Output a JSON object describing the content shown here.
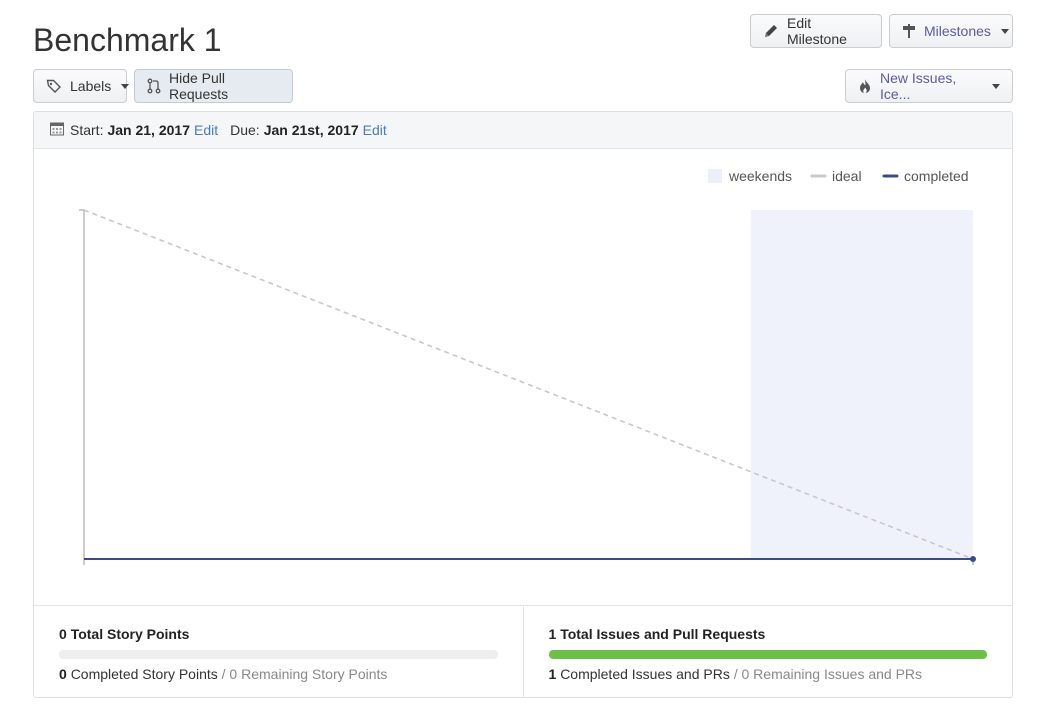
{
  "page": {
    "title": "Benchmark 1"
  },
  "toolbar": {
    "edit_milestone_label": "Edit Milestone",
    "milestones_label": "Milestones",
    "labels_label": "Labels",
    "hide_prs_label": "Hide Pull Requests",
    "mode_label": "New Issues, Ice..."
  },
  "dates": {
    "start_prefix": "Start:",
    "start_value": "Jan 21, 2017",
    "edit_label": "Edit",
    "due_prefix": "Due:",
    "due_value": "Jan 21st, 2017"
  },
  "legend": {
    "weekends": "weekends",
    "ideal": "ideal",
    "completed": "completed"
  },
  "colors": {
    "weekend": "#f0f2fb",
    "ideal": "#c8c8c8",
    "completed": "#3b4a8c",
    "progress": "#6cc04a",
    "link": "#4a7bbd",
    "accent": "#5a5aa6"
  },
  "chart_data": {
    "type": "line",
    "x": [
      "start",
      "end"
    ],
    "series": [
      {
        "name": "ideal",
        "style": "dashed",
        "values": [
          1,
          0
        ]
      },
      {
        "name": "completed",
        "style": "solid",
        "values": [
          0,
          0
        ]
      }
    ],
    "weekend_span": [
      0.75,
      1.0
    ],
    "ylim": [
      0,
      1
    ],
    "grid": false,
    "legend_position": "top-right"
  },
  "stats": {
    "story_points": {
      "title_count": "0",
      "title_label": "Total Story Points",
      "completed_count": "0",
      "completed_label": "Completed Story Points",
      "remaining": "/ 0 Remaining Story Points",
      "progress": 0
    },
    "issues": {
      "title_count": "1",
      "title_label": "Total Issues and Pull Requests",
      "completed_count": "1",
      "completed_label": "Completed Issues and PRs",
      "remaining": "/ 0 Remaining Issues and PRs",
      "progress": 1
    }
  }
}
